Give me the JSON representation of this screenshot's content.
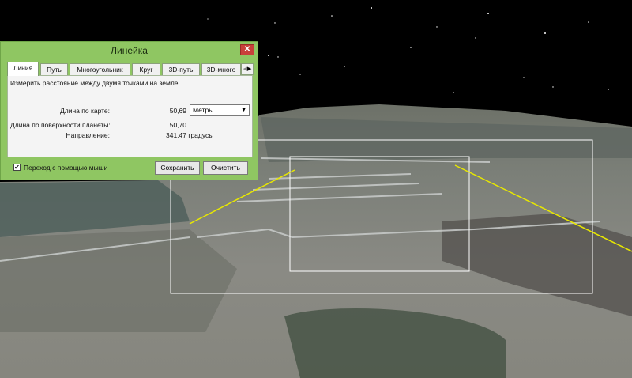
{
  "dialog": {
    "title": "Линейка",
    "close_icon": "close-icon",
    "tabs": [
      {
        "label": "Линия"
      },
      {
        "label": "Путь"
      },
      {
        "label": "Многоугольник"
      },
      {
        "label": "Круг"
      },
      {
        "label": "3D-путь"
      },
      {
        "label": "3D-много"
      }
    ],
    "active_tab": "Линия",
    "description": "Измерить расстояние между двумя точками на земле",
    "map_length_label": "Длина по карте:",
    "map_length_value": "50,69",
    "unit_select": {
      "value": "Метры"
    },
    "surface_length_label": "Длина по поверхности планеты:",
    "surface_length_value": "50,70",
    "heading_label": "Направление:",
    "heading_value": "341,47 градусы",
    "mouse_nav_label": "Переход с помощью мыши",
    "mouse_nav_checked": true,
    "save_label": "Сохранить",
    "clear_label": "Очистить"
  },
  "colors": {
    "dialog_frame": "#8fc662",
    "close_button": "#c8413a",
    "measure_line": "#e8e800"
  }
}
